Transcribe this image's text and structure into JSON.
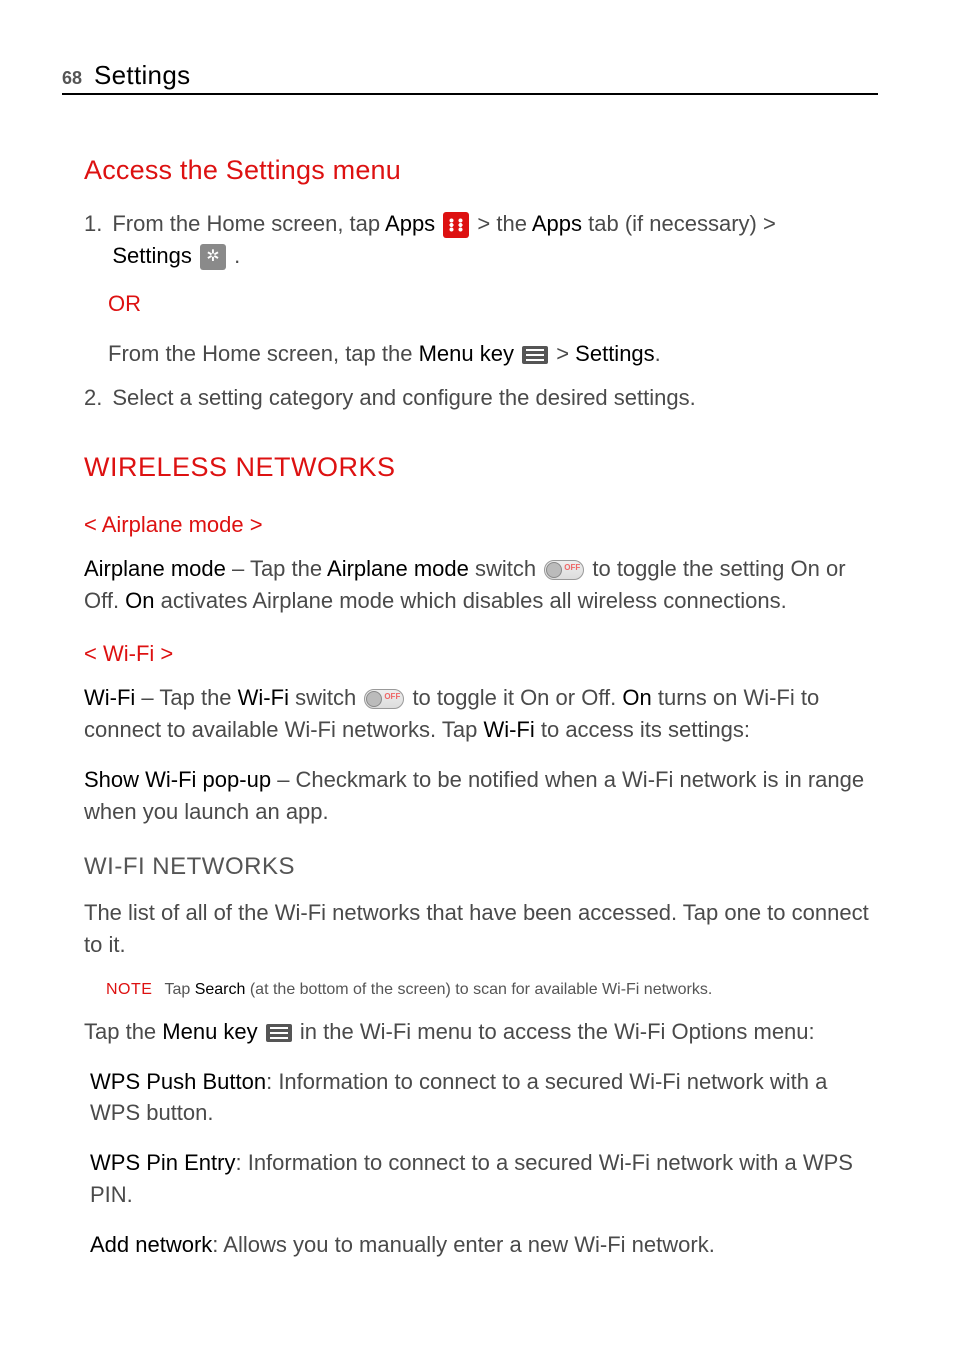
{
  "page": {
    "number": "68",
    "title": "Settings"
  },
  "headings": {
    "access": "Access the Settings menu",
    "wireless": "WIRELESS NETWORKS",
    "airplane": "< Airplane mode >",
    "wifi": "< Wi-Fi >",
    "wifi_networks": "WI-FI NETWORKS"
  },
  "step1": {
    "prefix": "1.",
    "t1": "From the Home screen, tap ",
    "apps": "Apps",
    "t2": "  >  the ",
    "apps_tab": "Apps",
    "t3": " tab (if necessary)  > ",
    "settings": "Settings",
    "t4": " ."
  },
  "or": "OR",
  "step1b": {
    "t1": "From the Home screen, tap the ",
    "menu_key": "Menu key",
    "t2": "  > ",
    "settings": "Settings",
    "t3": "."
  },
  "step2": {
    "prefix": "2.",
    "text": "Select a setting category and configure the desired settings."
  },
  "airplane_para": {
    "b1": "Airplane mode",
    "t1": " – Tap the ",
    "b2": "Airplane mode",
    "t2": " switch ",
    "t3": " to toggle the setting On or Off. ",
    "b3": "On",
    "t4": " activates Airplane mode which disables all wireless connections."
  },
  "wifi_para1": {
    "b1": "Wi-Fi",
    "t1": " – Tap the ",
    "b2": "Wi-Fi",
    "t2": " switch ",
    "t3": " to toggle it On or Off. ",
    "b3": "On",
    "t4": " turns on Wi-Fi to connect to available Wi-Fi networks. Tap ",
    "b4": "Wi-Fi",
    "t5": " to access its settings:"
  },
  "wifi_para2": {
    "b1": "Show Wi-Fi pop-up",
    "t1": " – Checkmark to be notified when a Wi-Fi network is in range when you launch an app."
  },
  "wifi_networks_para": "The list of all of the Wi-Fi networks that have been accessed. Tap one to connect to it.",
  "note": {
    "label": "NOTE",
    "t1": "Tap ",
    "b1": "Search",
    "t2": " (at the bottom of the screen) to scan for available Wi-Fi networks."
  },
  "menu_intro": {
    "t1": "Tap the ",
    "b1": "Menu key",
    "t2": " in the Wi-Fi menu to access the Wi-Fi Options menu:"
  },
  "options": {
    "wps_push": {
      "b": "WPS Push Button",
      "t": ": Information to connect to a secured Wi-Fi network with a WPS button."
    },
    "wps_pin": {
      "b": "WPS Pin Entry",
      "t": ": Information to connect to a secured Wi-Fi network with a WPS PIN."
    },
    "add_net": {
      "b": "Add network",
      "t": ": Allows you to manually enter a new Wi-Fi network."
    }
  }
}
